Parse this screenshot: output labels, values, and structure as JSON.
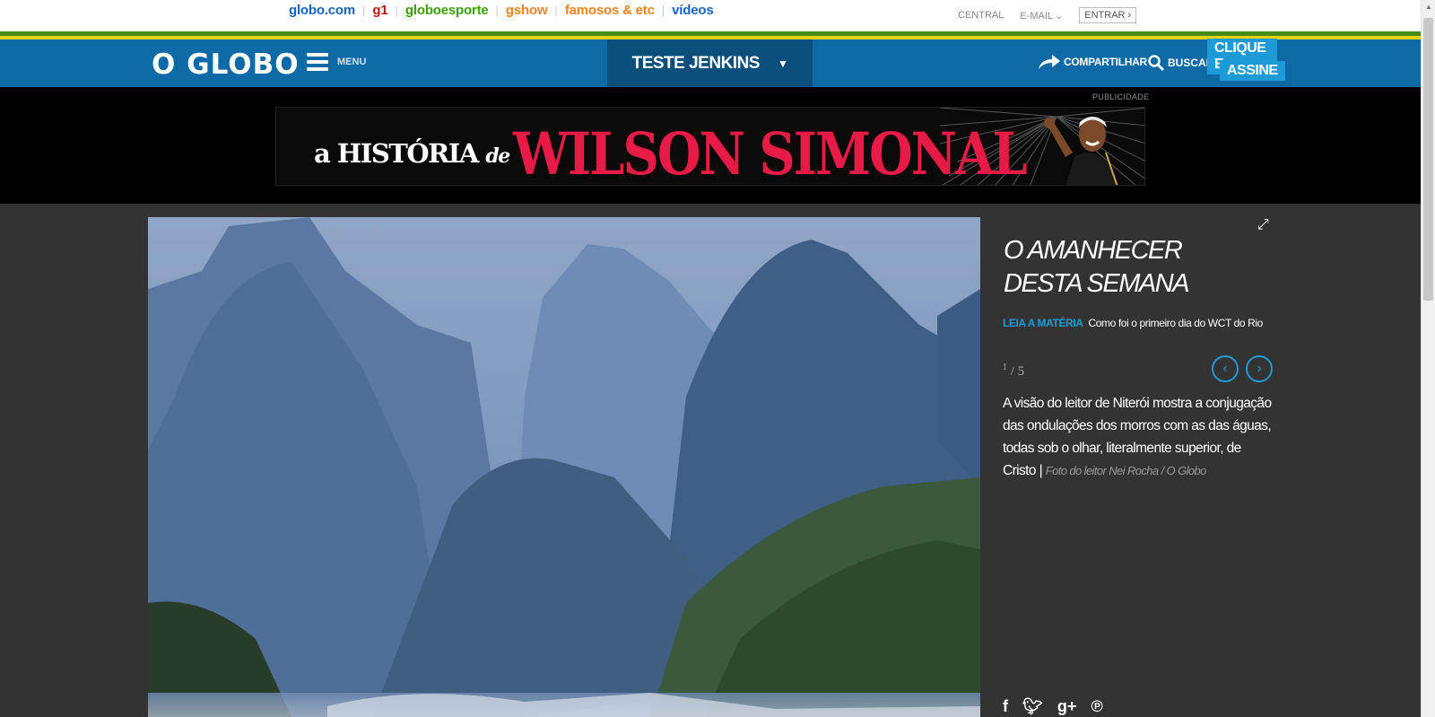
{
  "portals": [
    {
      "label": "globo.com",
      "color": "#1565c0"
    },
    {
      "label": "g1",
      "color": "#c4170c"
    },
    {
      "label": "globoesporte",
      "color": "#39a101"
    },
    {
      "label": "gshow",
      "color": "#f3841b"
    },
    {
      "label": "famosos & etc",
      "color": "#f3841b"
    },
    {
      "label": "vídeos",
      "color": "#1565c0"
    }
  ],
  "toplinks": {
    "central": "CENTRAL",
    "email": "E-MAIL",
    "entrar": "ENTRAR ›"
  },
  "header": {
    "logo": "O GLOBO",
    "menu": "MENU",
    "section": "TESTE JENKINS",
    "share": "COMPARTILHAR",
    "search": "BUSCAR",
    "cta_line1": "CLIQUE E",
    "cta_line2": "ASSINE"
  },
  "ad": {
    "label": "PUBLICIDADE",
    "prefix": "a HISTÓRIA",
    "prefix_de": "de",
    "name": "WILSON SIMONAL"
  },
  "gallery": {
    "title": "O AMANHECER DESTA SEMANA",
    "read_label": "LEIA A MATÉRIA",
    "read_link": "Como foi o primeiro dia do WCT do Rio",
    "current": "1",
    "total": "/ 5",
    "caption": "A visão do leitor de Niterói mostra a conjugação das ondulações dos morros com as das águas, todas sob o olhar, literalmente superior, de Cristo |",
    "credit": "Foto do leitor Nei Rocha / O Globo"
  },
  "icons": {
    "share": "share-arrow-icon",
    "search": "search-icon",
    "expand": "expand-icon",
    "prev": "chevron-left-icon",
    "next": "chevron-right-icon"
  },
  "colors": {
    "header": "#0d6aa6",
    "accent": "#1e9bd7",
    "ad_red": "#e81a46"
  }
}
